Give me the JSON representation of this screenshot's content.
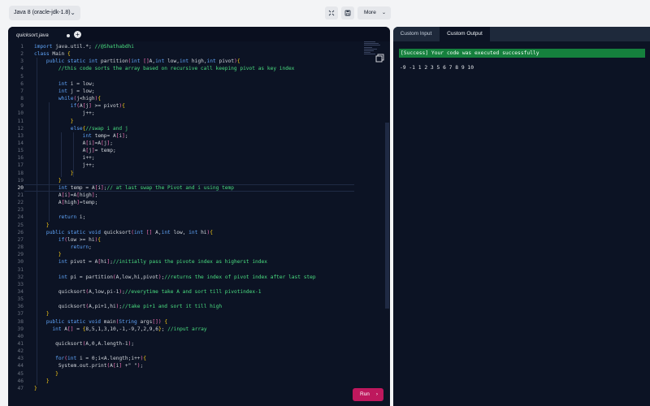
{
  "toolbar": {
    "language": "Java 8 (oracle-jdk-1.8)",
    "more_label": "More"
  },
  "editor": {
    "tab_name": "quicksort.java",
    "run_label": "Run",
    "active_line": 20,
    "lines": [
      {
        "n": 1,
        "indent": 0,
        "text": "import java.util.*; //@Shathabdhi"
      },
      {
        "n": 2,
        "indent": 0,
        "text": "class Main {"
      },
      {
        "n": 3,
        "indent": 4,
        "text": "public static int partition(int []A,int low,int high,int pivot){"
      },
      {
        "n": 4,
        "indent": 8,
        "text": "//this code sorts the array based on recursive call keeping pivot as key index"
      },
      {
        "n": 5,
        "indent": 0,
        "text": ""
      },
      {
        "n": 6,
        "indent": 8,
        "text": "int i = low;"
      },
      {
        "n": 7,
        "indent": 8,
        "text": "int j = low;"
      },
      {
        "n": 8,
        "indent": 8,
        "text": "while(j<high){"
      },
      {
        "n": 9,
        "indent": 12,
        "text": "if(A[j] >= pivot){"
      },
      {
        "n": 10,
        "indent": 16,
        "text": "j++;"
      },
      {
        "n": 11,
        "indent": 12,
        "text": "}"
      },
      {
        "n": 12,
        "indent": 12,
        "text": "else{//swap i and j"
      },
      {
        "n": 13,
        "indent": 16,
        "text": "int temp= A[i];"
      },
      {
        "n": 14,
        "indent": 16,
        "text": "A[i]=A[j];"
      },
      {
        "n": 15,
        "indent": 16,
        "text": "A[j]= temp;"
      },
      {
        "n": 16,
        "indent": 16,
        "text": "i++;"
      },
      {
        "n": 17,
        "indent": 16,
        "text": "j++;"
      },
      {
        "n": 18,
        "indent": 12,
        "text": "}"
      },
      {
        "n": 19,
        "indent": 8,
        "text": "}"
      },
      {
        "n": 20,
        "indent": 8,
        "text": "int temp = A[i];// at last swap the Pivot and i using temp"
      },
      {
        "n": 21,
        "indent": 8,
        "text": "A[i]=A[high];"
      },
      {
        "n": 22,
        "indent": 8,
        "text": "A[high]=temp;"
      },
      {
        "n": 23,
        "indent": 0,
        "text": ""
      },
      {
        "n": 24,
        "indent": 8,
        "text": "return i;"
      },
      {
        "n": 25,
        "indent": 4,
        "text": "}"
      },
      {
        "n": 26,
        "indent": 4,
        "text": "public static void quicksort(int [] A,int low, int hi){"
      },
      {
        "n": 27,
        "indent": 8,
        "text": "if(low >= hi){"
      },
      {
        "n": 28,
        "indent": 12,
        "text": "return;"
      },
      {
        "n": 29,
        "indent": 8,
        "text": "}"
      },
      {
        "n": 30,
        "indent": 8,
        "text": "int pivot = A[hi];//initially pass the pivote index as higherst index"
      },
      {
        "n": 31,
        "indent": 0,
        "text": ""
      },
      {
        "n": 32,
        "indent": 8,
        "text": "int pi = partition(A,low,hi,pivot);//returns the index of pivot index after last step"
      },
      {
        "n": 33,
        "indent": 0,
        "text": ""
      },
      {
        "n": 34,
        "indent": 8,
        "text": "quicksort(A,low,pi-1);//everytime take A and sort till pivotindex-1"
      },
      {
        "n": 35,
        "indent": 0,
        "text": ""
      },
      {
        "n": 36,
        "indent": 8,
        "text": "quicksort(A,pi+1,hi);//take pi+1 and sort it till high"
      },
      {
        "n": 37,
        "indent": 4,
        "text": "}"
      },
      {
        "n": 38,
        "indent": 4,
        "text": "public static void main(String args[]) {"
      },
      {
        "n": 39,
        "indent": 6,
        "text": "int A[] = {8,5,1,3,10,-1,-9,7,2,9,6}; //input array"
      },
      {
        "n": 40,
        "indent": 0,
        "text": ""
      },
      {
        "n": 41,
        "indent": 7,
        "text": "quicksort(A,0,A.length-1);"
      },
      {
        "n": 42,
        "indent": 0,
        "text": ""
      },
      {
        "n": 43,
        "indent": 7,
        "text": "for(int i = 0;i<A.length;i++){"
      },
      {
        "n": 44,
        "indent": 8,
        "text": "System.out.print(A[i] +\" \");"
      },
      {
        "n": 45,
        "indent": 7,
        "text": "}"
      },
      {
        "n": 46,
        "indent": 4,
        "text": "}"
      },
      {
        "n": 47,
        "indent": 0,
        "text": "}"
      }
    ]
  },
  "output": {
    "tab_input": "Custom Input",
    "tab_output": "Custom Output",
    "success_message": "[Success] Your code was executed successfully",
    "result": "-9 -1 1 2 3 5 6 7 8 9 10"
  },
  "colors": {
    "keyword": "#60a5fa",
    "comment": "#4ade80",
    "bracket_pink": "#f472b6",
    "bracket_yellow": "#facc15",
    "text": "#d1d5db",
    "run_button": "#be185d",
    "success": "#15803d"
  }
}
